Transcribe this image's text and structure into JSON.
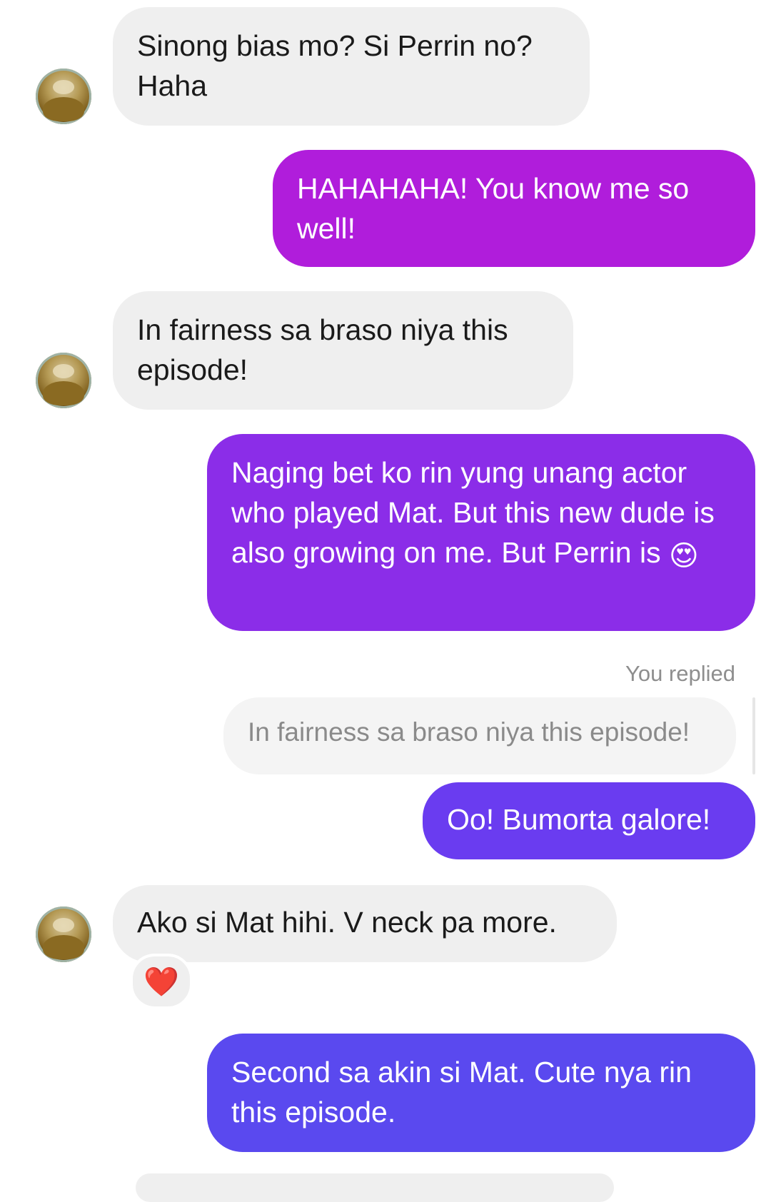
{
  "colors": {
    "incoming_bubble": "#efefef",
    "outgoing_1": "#b01ddb",
    "outgoing_2": "#8b2de8",
    "outgoing_3": "#6a3cf0",
    "outgoing_4": "#5a49ef"
  },
  "messages": [
    {
      "from": "other",
      "text": "Sinong bias mo? Si Perrin no? Haha"
    },
    {
      "from": "me",
      "text": "HAHAHAHA! You know me so well!"
    },
    {
      "from": "other",
      "text": "In fairness sa braso niya this episode!"
    },
    {
      "from": "me",
      "text": "Naging bet ko rin yung unang actor who played Mat. But this new dude is also growing on me. But Perrin is",
      "emoji": "😍",
      "emoji_name": "heart-eyes-emoji"
    },
    {
      "from": "me",
      "reply_label": "You replied",
      "quoted": "In fairness sa braso niya this episode!",
      "text": "Oo! Bumorta galore!"
    },
    {
      "from": "other",
      "text": "Ako si Mat hihi. V neck pa more.",
      "reaction": "❤️",
      "reaction_name": "heart-reaction-icon"
    },
    {
      "from": "me",
      "text": "Second sa akin si Mat. Cute nya rin this episode."
    }
  ]
}
